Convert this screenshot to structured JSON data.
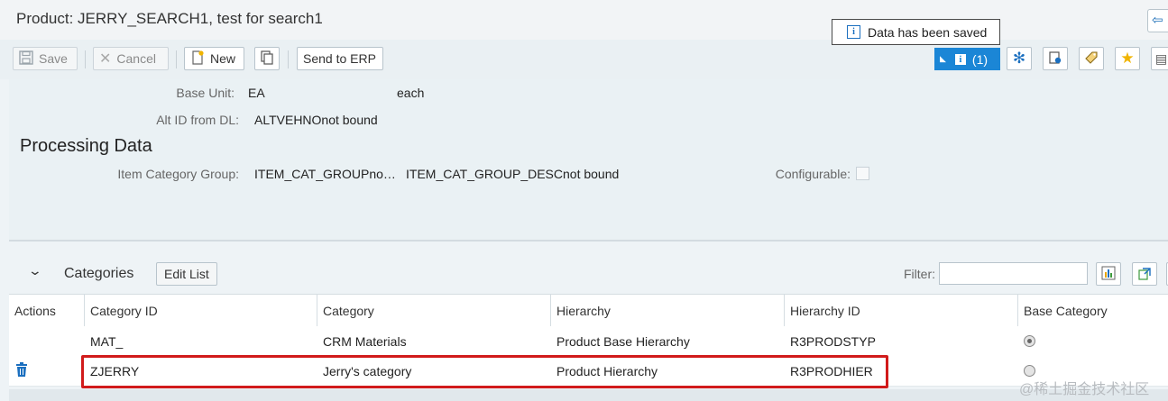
{
  "header": {
    "title": "Product: JERRY_SEARCH1, test for search1"
  },
  "toolbar": {
    "save_label": "Save",
    "cancel_label": "Cancel",
    "new_label": "New",
    "send_label": "Send to ERP",
    "messages_label": "(1)"
  },
  "tooltip": {
    "text": "Data has been saved"
  },
  "form": {
    "base_unit_label": "Base Unit:",
    "base_unit_value": "EA",
    "base_unit_desc": "each",
    "alt_id_label": "Alt ID from DL:",
    "alt_id_value": "ALTVEHNOnot bound",
    "section_title": "Processing Data",
    "item_cat_label": "Item Category Group:",
    "item_cat_value": "ITEM_CAT_GROUPno…",
    "item_cat_desc": "ITEM_CAT_GROUP_DESCnot bound",
    "configurable_label": "Configurable:"
  },
  "categories": {
    "title": "Categories",
    "edit_list_label": "Edit List",
    "filter_label": "Filter:",
    "filter_value": "",
    "columns": [
      "Actions",
      "Category ID",
      "Category",
      "Hierarchy",
      "Hierarchy ID",
      "Base Category"
    ],
    "rows": [
      {
        "category_id": "MAT_",
        "category": "CRM Materials",
        "hierarchy": "Product Base Hierarchy",
        "hierarchy_id": "R3PRODSTYP",
        "base_category": true,
        "has_delete": false
      },
      {
        "category_id": "ZJERRY",
        "category": "Jerry's category",
        "hierarchy": "Product Hierarchy",
        "hierarchy_id": "R3PRODHIER",
        "base_category": false,
        "has_delete": true
      }
    ]
  },
  "watermark": "@稀土掘金技术社区",
  "colors": {
    "accent": "#1b86d6",
    "highlight": "#d11b1b",
    "delete_icon": "#1b6fbf"
  },
  "icons": [
    "save-icon",
    "cancel-icon",
    "new-icon",
    "copy-icon",
    "info-icon",
    "settings-icon",
    "personalize-icon",
    "tag-icon",
    "favorite-icon",
    "back-icon",
    "chart-icon",
    "export-icon",
    "trash-icon"
  ]
}
